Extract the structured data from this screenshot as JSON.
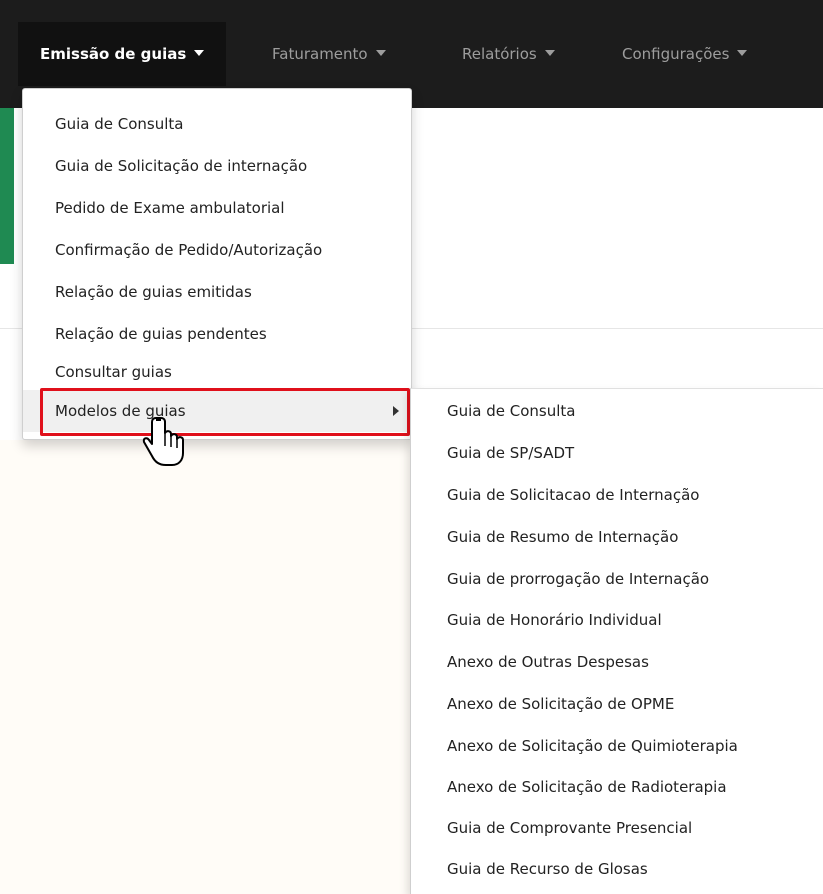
{
  "nav": {
    "items": [
      {
        "label": "Emissão de guias"
      },
      {
        "label": "Faturamento"
      },
      {
        "label": "Relatórios"
      },
      {
        "label": "Configurações"
      }
    ]
  },
  "dropdown": {
    "items": [
      {
        "label": "Guia de Consulta"
      },
      {
        "label": "Guia de Solicitação de internação"
      },
      {
        "label": "Pedido de Exame ambulatorial"
      },
      {
        "label": "Confirmação de Pedido/Autorização"
      },
      {
        "label": "Relação de guias emitidas"
      },
      {
        "label": "Relação de guias pendentes"
      },
      {
        "label": "Consultar guias"
      },
      {
        "label": "Modelos de guias"
      }
    ]
  },
  "submenu": {
    "items": [
      {
        "label": "Guia de Consulta"
      },
      {
        "label": "Guia de SP/SADT"
      },
      {
        "label": "Guia de Solicitacao de Internação"
      },
      {
        "label": "Guia de Resumo de Internação"
      },
      {
        "label": "Guia de prorrogação de Internação"
      },
      {
        "label": "Guia de Honorário Individual"
      },
      {
        "label": "Anexo de Outras Despesas"
      },
      {
        "label": "Anexo de Solicitação de OPME"
      },
      {
        "label": "Anexo de Solicitação de Quimioterapia"
      },
      {
        "label": "Anexo de Solicitação de Radioterapia"
      },
      {
        "label": "Guia de Comprovante Presencial"
      },
      {
        "label": "Guia de Recurso de Glosas"
      }
    ]
  },
  "colors": {
    "navbar": "#1c1c1c",
    "highlight": "#e0101b",
    "accent_green": "#1f8a52"
  },
  "icons": {
    "cursor": "hand-pointer-icon",
    "submenu_arrow": "caret-right-icon",
    "nav_caret": "caret-down-icon"
  }
}
